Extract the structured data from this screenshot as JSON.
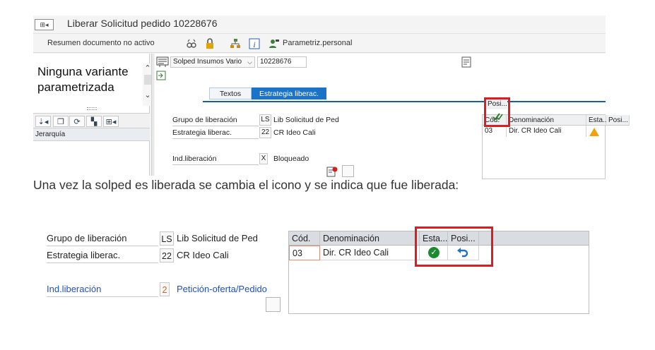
{
  "shot1": {
    "window_title": "Liberar Solicitud pedido 10228676",
    "menu_button": "⊞◂",
    "toolbar": {
      "summary_label": "Resumen documento no activo",
      "param_label": "Parametriz.personal"
    },
    "left_pane": {
      "variant_text": "Ninguna variante parametrizada",
      "tree_header": "Jerarquía"
    },
    "doc_header": {
      "doc_type": "Solped Insumos Vario",
      "doc_number": "10228676"
    },
    "tabs": [
      {
        "label": "Textos"
      },
      {
        "label": "Estrategia liberac."
      }
    ],
    "fields": {
      "grupo_label": "Grupo de liberación",
      "grupo_code": "LS",
      "grupo_text": "Lib Solicitud de Ped",
      "estrategia_label": "Estrategia liberac.",
      "estrategia_code": "22",
      "estrategia_text": "CR Ideo Cali",
      "ind_label": "Ind.liberación",
      "ind_code": "X",
      "ind_text": "Bloqueado"
    },
    "grid": {
      "headers": [
        "Cód.",
        "Denominación",
        "Esta..",
        "Posi..."
      ],
      "row": {
        "cod": "03",
        "denominacion": "Dir. CR Ideo Cali",
        "estado_icon": "warning-triangle-icon",
        "posicion_icon": "release-check-icon"
      }
    }
  },
  "caption": "Una vez la solped es liberada se cambia el icono y se indica que fue liberada:",
  "shot2": {
    "fields": {
      "grupo_label": "Grupo de liberación",
      "grupo_code": "LS",
      "grupo_text": "Lib Solicitud de Ped",
      "estrategia_label": "Estrategia liberac.",
      "estrategia_code": "22",
      "estrategia_text": "CR Ideo Cali",
      "ind_label": "Ind.liberación",
      "ind_code": "2",
      "ind_text": "Petición-oferta/Pedido"
    },
    "grid": {
      "headers": [
        "Cód.",
        "Denominación",
        "Esta...",
        "Posi..."
      ],
      "row": {
        "cod": "03",
        "denominacion": "Dir. CR Ideo Cali",
        "estado_icon": "released-ok-icon",
        "posicion_icon": "undo-release-icon"
      }
    }
  },
  "colors": {
    "highlight_red": "#e01a1f",
    "tab_active_blue": "#1a73c6",
    "link_blue": "#1f4fcc",
    "ok_green": "#1d8a2e"
  }
}
